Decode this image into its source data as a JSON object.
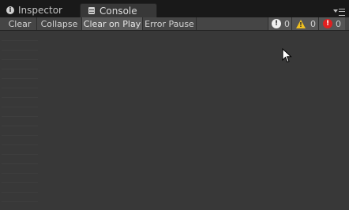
{
  "tabs": {
    "inspector": {
      "label": "Inspector",
      "icon": "info-icon"
    },
    "console": {
      "label": "Console",
      "icon": "console-icon"
    }
  },
  "toolbar": {
    "clear_label": "Clear",
    "collapse_label": "Collapse",
    "clear_on_play_label": "Clear on Play",
    "error_pause_label": "Error Pause"
  },
  "counters": {
    "log": {
      "count": "0",
      "icon": "info-circle-icon",
      "color": "#f0f0f0"
    },
    "warning": {
      "count": "0",
      "icon": "warning-triangle-icon",
      "color": "#f0c020"
    },
    "error": {
      "count": "0",
      "icon": "error-circle-icon",
      "color": "#e02020"
    }
  },
  "colors": {
    "panel_bg": "#383838",
    "toolbar_bg": "#454545",
    "tabbar_bg": "#191919"
  }
}
